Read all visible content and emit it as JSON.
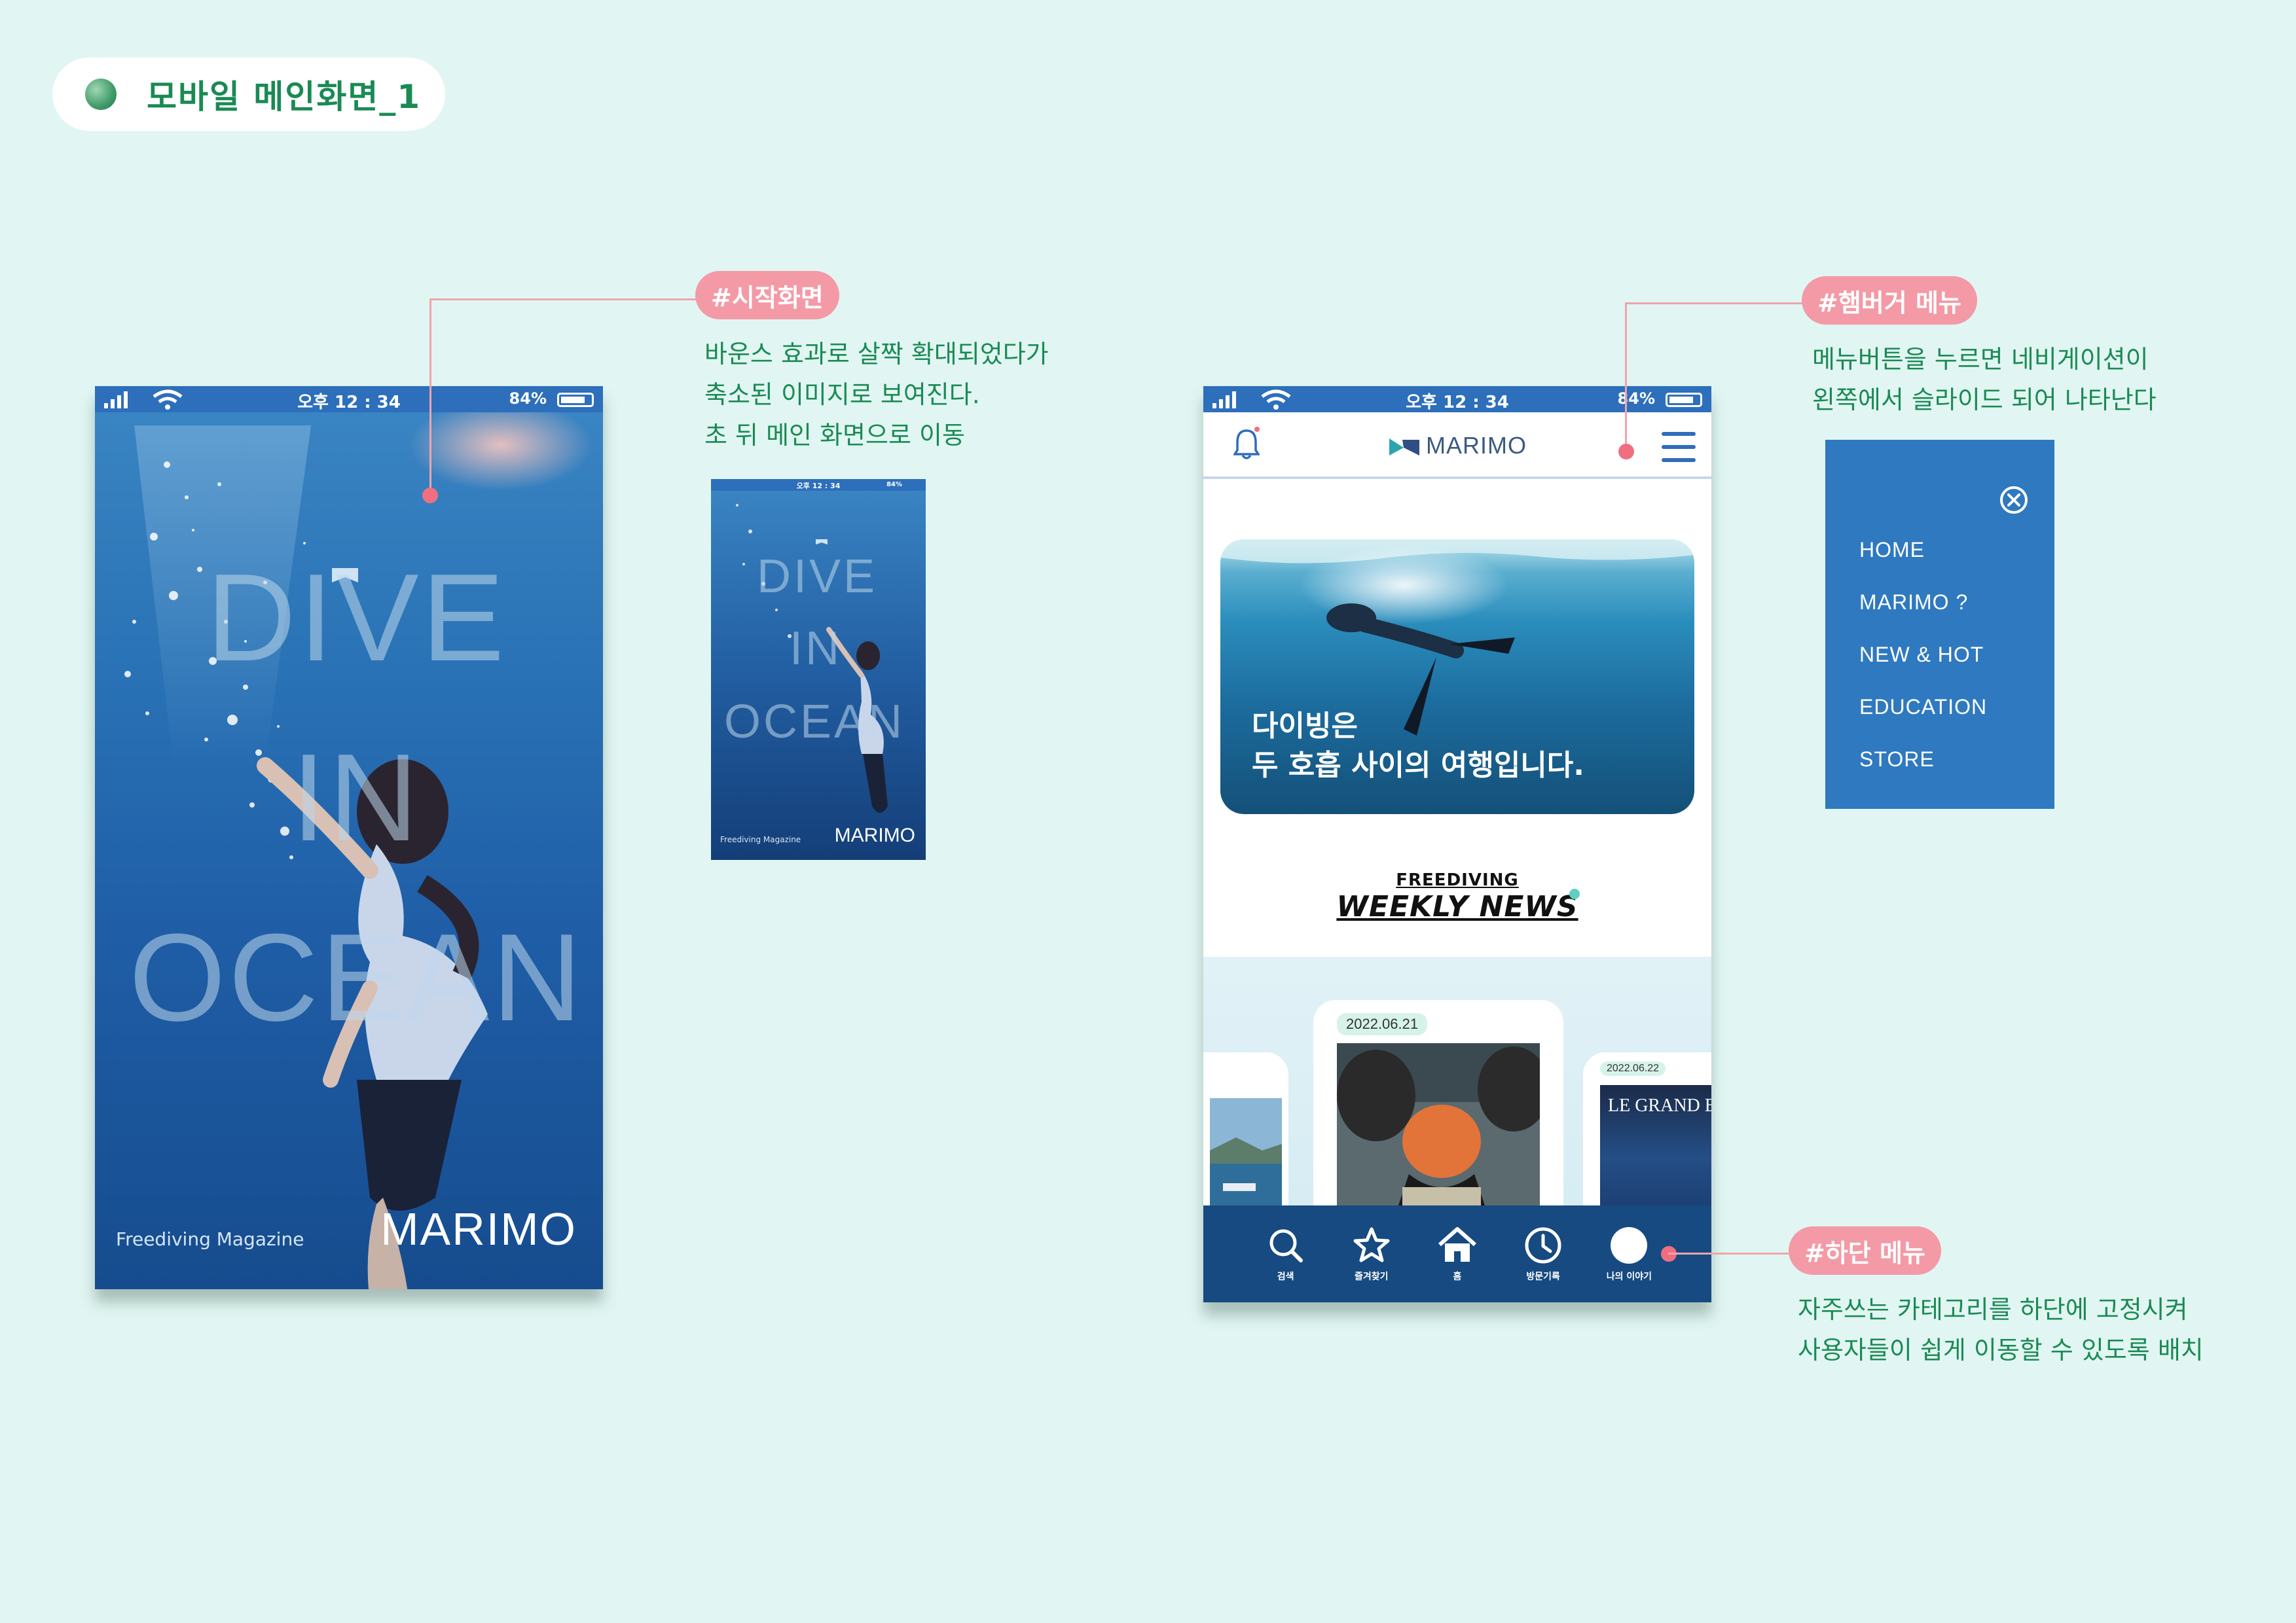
{
  "page": {
    "title": "모바일 메인화면_1"
  },
  "annotations": {
    "start": {
      "tag": "#시작화면",
      "lines": [
        "바운스 효과로 살짝 확대되었다가",
        "축소된 이미지로 보여진다.",
        "초 뒤 메인 화면으로 이동"
      ]
    },
    "hamburger": {
      "tag": "#햄버거 메뉴",
      "lines": [
        "메뉴버튼을 누르면 네비게이션이",
        "왼쪽에서 슬라이드 되어 나타난다"
      ]
    },
    "bottom": {
      "tag": "#하단 메뉴",
      "lines": [
        "자주쓰는 카테고리를 하단에 고정시켜",
        "사용자들이 쉽게 이동할 수 있도록 배치"
      ]
    }
  },
  "statusbar": {
    "time": "오후 12 : 34",
    "battery": "84%"
  },
  "splash": {
    "words": [
      "DIVE",
      "IN",
      "OCEAN"
    ],
    "magazine": "Freediving Magazine",
    "brand": "MARIMO"
  },
  "main": {
    "logo": "MARIMO",
    "hero_lines": [
      "다이빙은",
      "두 호흡 사이의 여행입니다."
    ],
    "news_small": "FREEDIVING",
    "news_big": "WEEKLY NEWS",
    "cards": [
      {
        "date": "2022.06.21"
      },
      {
        "date": "2022.06.22",
        "text": "LE GRAND B"
      }
    ],
    "bottom_nav": [
      {
        "icon": "search-icon",
        "label": "검색"
      },
      {
        "icon": "star-icon",
        "label": "즐겨찾기"
      },
      {
        "icon": "home-icon",
        "label": "홈"
      },
      {
        "icon": "clock-icon",
        "label": "방문기록"
      },
      {
        "icon": "profile-icon",
        "label": "나의 이야기"
      }
    ]
  },
  "side_menu": {
    "items": [
      "HOME",
      "MARIMO ?",
      "NEW & HOT",
      "EDUCATION",
      "STORE"
    ]
  },
  "colors": {
    "background": "#e1f6f2",
    "accent_green": "#1b8a55",
    "tag_pink": "#f39aa6",
    "status_blue": "#2d6fbb",
    "nav_blue": "#164a80",
    "menu_blue": "#2f79c0"
  }
}
